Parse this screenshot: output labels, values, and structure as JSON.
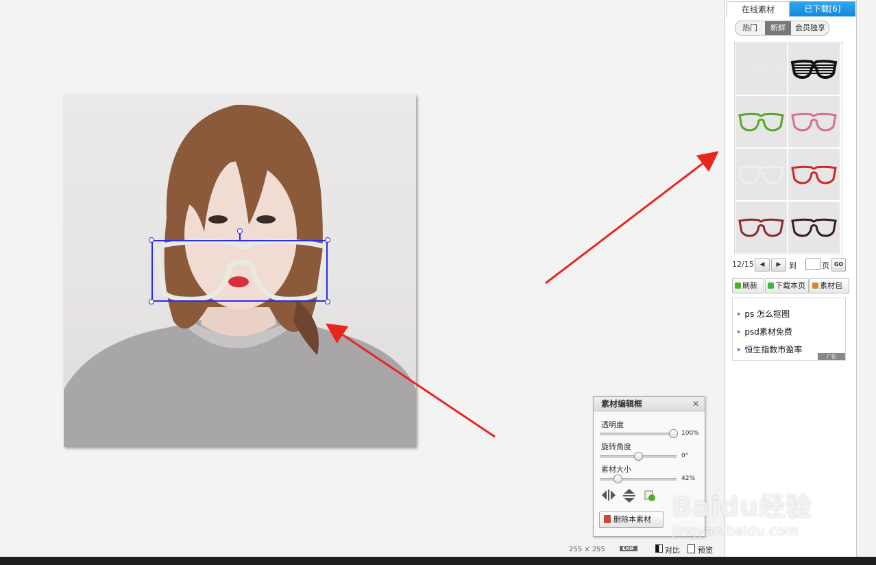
{
  "panel": {
    "tabs": [
      "在线素材",
      "已下载[6]"
    ],
    "filters": [
      "热门",
      "新鲜",
      "会员独享"
    ],
    "active_filter": "新鲜",
    "grid_items": [
      {
        "icon": "shutter-glasses-white-icon",
        "color": "#e8e8e8"
      },
      {
        "icon": "shutter-glasses-black-icon",
        "color": "#111111"
      },
      {
        "icon": "glasses-green-icon",
        "color": "#5aa52a"
      },
      {
        "icon": "glasses-pink-icon",
        "color": "#d9708a"
      },
      {
        "icon": "glasses-white-icon",
        "color": "#f0f0ea"
      },
      {
        "icon": "glasses-red-icon",
        "color": "#c82a2a"
      },
      {
        "icon": "glasses-burgundy-icon",
        "color": "#8a2a2e"
      },
      {
        "icon": "glasses-dark-brown-icon",
        "color": "#3a1a1a"
      }
    ],
    "pager": {
      "current": "12/15",
      "goto_label": "到",
      "page_label": "页",
      "go": "GO"
    },
    "actions": [
      "刷新",
      "下载本页",
      "素材包"
    ],
    "links": [
      "ps 怎么抠图",
      "psd素材免费",
      "恒生指数市盈率"
    ],
    "ad_badge": "广告"
  },
  "editbox": {
    "title": "素材编辑框",
    "close": "✕",
    "sliders": [
      {
        "label": "透明度",
        "value": "100%",
        "level": 1.0
      },
      {
        "label": "旋转角度",
        "value": "0°",
        "level": 0.5
      },
      {
        "label": "素材大小",
        "value": "42%",
        "level": 0.2
      }
    ],
    "tools": [
      "flip-horizontal-icon",
      "flip-vertical-icon",
      "copy-layer-icon"
    ],
    "delete_label": "删除本素材"
  },
  "status": {
    "size": "255 × 255",
    "exif": "EXIF",
    "compare": "对比",
    "preview": "预览"
  },
  "watermark": {
    "brand": "Baidu经验",
    "url": "jingyan.baidu.com"
  },
  "colors": {
    "selection": "#2a2af0",
    "arrow": "#e8261e",
    "tab_active": "#1a90e0"
  }
}
